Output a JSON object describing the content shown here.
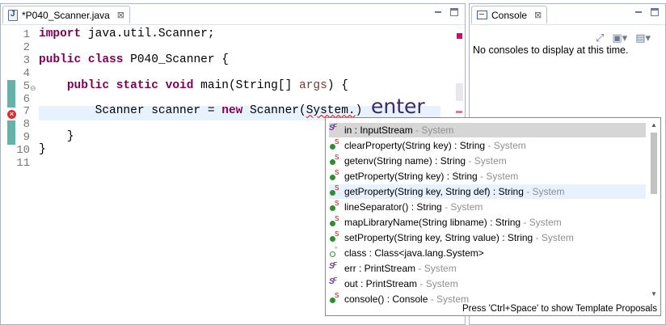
{
  "editor": {
    "tab_label": "*P040_Scanner.java",
    "close_glyph": "⊠",
    "lines": [
      {
        "n": "1",
        "parts": [
          {
            "t": "import",
            "c": "kw"
          },
          {
            "t": " java.util.Scanner;"
          }
        ]
      },
      {
        "n": "2",
        "parts": []
      },
      {
        "n": "3",
        "parts": [
          {
            "t": "public",
            "c": "kw"
          },
          {
            "t": " "
          },
          {
            "t": "class",
            "c": "kw"
          },
          {
            "t": " P040_Scanner {"
          }
        ]
      },
      {
        "n": "4",
        "parts": []
      },
      {
        "n": "5",
        "parts": [
          {
            "t": "    "
          },
          {
            "t": "public",
            "c": "kw"
          },
          {
            "t": " "
          },
          {
            "t": "static",
            "c": "kw"
          },
          {
            "t": " "
          },
          {
            "t": "void",
            "c": "kw"
          },
          {
            "t": " main(String[] "
          },
          {
            "t": "args",
            "c": "param"
          },
          {
            "t": ") {"
          }
        ]
      },
      {
        "n": "6",
        "parts": []
      },
      {
        "n": "7",
        "parts": [
          {
            "t": "        Scanner scanner = "
          },
          {
            "t": "new",
            "c": "kw"
          },
          {
            "t": " Scanner("
          },
          {
            "t": "System.",
            "c": "squig"
          },
          {
            "t": ")"
          }
        ]
      },
      {
        "n": "8",
        "parts": []
      },
      {
        "n": "9",
        "parts": [
          {
            "t": "    }"
          }
        ]
      },
      {
        "n": "10",
        "parts": [
          {
            "t": "}"
          }
        ]
      },
      {
        "n": "11",
        "parts": []
      }
    ],
    "annotation": "enter"
  },
  "console": {
    "tab_label": "Console",
    "close_glyph": "⊠",
    "message": "No consoles to display at this time."
  },
  "proposals": {
    "items": [
      {
        "icon": "static-final-field-icon",
        "main": "in : InputStream",
        "dim": " - System",
        "selected": true
      },
      {
        "icon": "static-method-icon",
        "main": "clearProperty(String key) : String",
        "dim": " - System"
      },
      {
        "icon": "static-method-icon",
        "main": "getenv(String name) : String",
        "dim": " - System"
      },
      {
        "icon": "static-method-icon",
        "main": "getProperty(String key) : String",
        "dim": " - System"
      },
      {
        "icon": "static-method-icon",
        "main": "getProperty(String key, String def) : String",
        "dim": " - System",
        "hover": true
      },
      {
        "icon": "static-method-icon",
        "main": "lineSeparator() : String",
        "dim": " - System"
      },
      {
        "icon": "static-method-icon",
        "main": "mapLibraryName(String libname) : String",
        "dim": " - System"
      },
      {
        "icon": "static-method-icon",
        "main": "setProperty(String key, String value) : String",
        "dim": " - System"
      },
      {
        "icon": "class-literal-icon",
        "main": "class : Class<java.lang.System>",
        "dim": ""
      },
      {
        "icon": "static-final-field-icon",
        "main": "err : PrintStream",
        "dim": " - System"
      },
      {
        "icon": "static-final-field-icon",
        "main": "out : PrintStream",
        "dim": " - System"
      },
      {
        "icon": "static-method-icon",
        "main": "console() : Console",
        "dim": " - System"
      }
    ],
    "status": "Press 'Ctrl+Space' to show Template Proposals"
  }
}
